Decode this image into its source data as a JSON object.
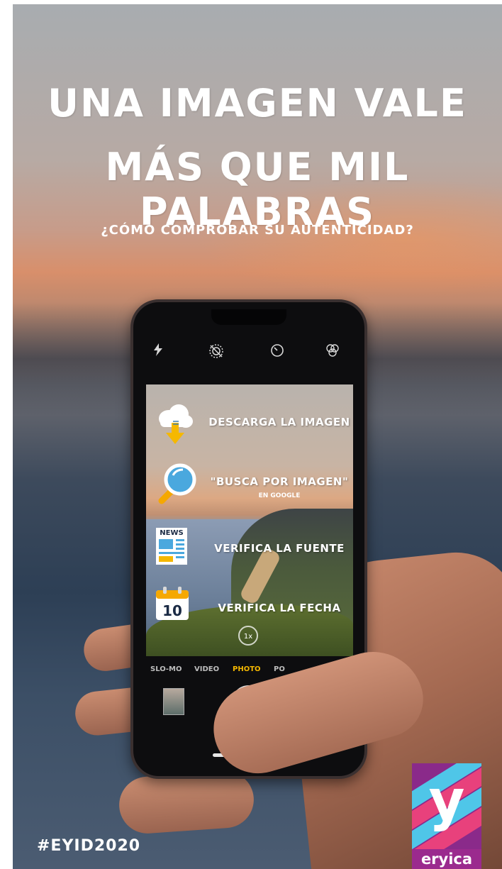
{
  "poster": {
    "title_line1": "UNA IMAGEN VALE",
    "title_line2": "MÁS QUE MIL PALABRAS",
    "subtitle": "¿CÓMO COMPROBAR SU AUTENTICIDAD?",
    "hashtag": "#EYID2020",
    "logo_text": "eryica",
    "logo_mark": "y"
  },
  "steps": [
    {
      "label": "DESCARGA LA IMAGEN",
      "icon": "cloud-download-icon"
    },
    {
      "label": "\"BUSCA POR IMAGEN\"",
      "sublabel": "EN GOOGLE",
      "icon": "magnifier-icon"
    },
    {
      "label": "VERIFICA LA FUENTE",
      "icon": "newspaper-icon",
      "icon_text": "NEWS"
    },
    {
      "label": "VERIFICA LA FECHA",
      "icon": "calendar-icon",
      "icon_text": "10"
    }
  ],
  "camera": {
    "modes": [
      "SLO-MO",
      "VIDEO",
      "PHOTO",
      "PO"
    ],
    "active_mode": "PHOTO",
    "zoom": "1x",
    "top_icons": [
      "flash-icon",
      "live-photo-icon",
      "timer-icon",
      "filters-icon"
    ]
  },
  "colors": {
    "accent_yellow": "#f5b800",
    "logo_purple": "#8a2a8a",
    "logo_cyan": "#4fc6e8",
    "logo_pink": "#e8417c"
  }
}
